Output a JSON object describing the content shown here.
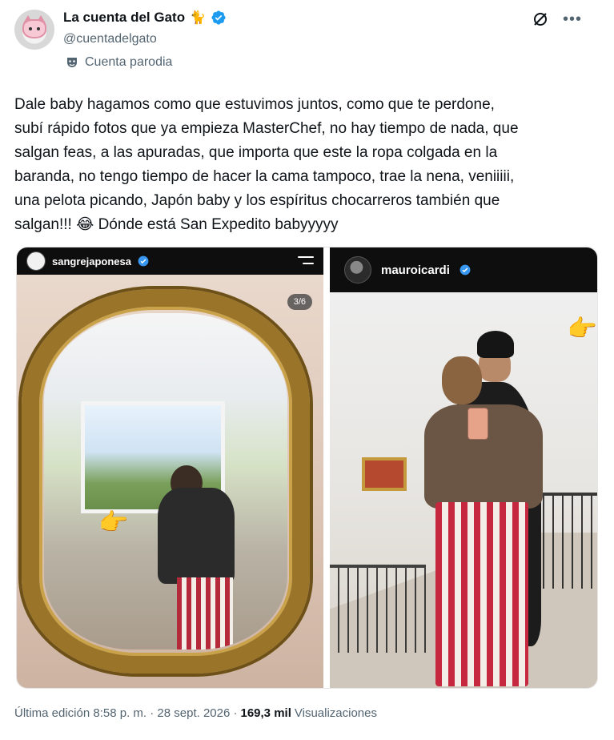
{
  "author": {
    "display_name": "La cuenta del Gato",
    "name_emoji": "🐈",
    "handle": "@cuentadelgato",
    "label": "Cuenta parodia",
    "verified_color": "#1d9bf0"
  },
  "tweet": {
    "text": "Dale baby hagamos como que estuvimos juntos, como que te perdone,\nsubí rápido fotos que ya empieza MasterChef, no hay tiempo de nada, que\nsalgan feas, a las apuradas, que importa que este la ropa colgada en la\nbaranda, no tengo tiempo de hacer la cama tampoco, trae la nena, veniiiii,\nuna pelota picando, Japón baby y los espíritus chocarreros también que\nsalgan!!! 😂 Dónde está San Expedito babyyyyy"
  },
  "media": {
    "left": {
      "username": "sangrejaponesa",
      "counter": "3/6",
      "emoji": "👉"
    },
    "right": {
      "username": "mauroicardi",
      "emoji": "👉"
    }
  },
  "footer": {
    "edited": "Última edición 8:58 p. m. · 28 sept. 2026 ·",
    "views_count": "169,3 mil",
    "views_label": "Visualizaciones"
  },
  "icons": {
    "more": "more-horizontal-icon",
    "grok": "grok-icon",
    "parody": "mask-icon"
  }
}
